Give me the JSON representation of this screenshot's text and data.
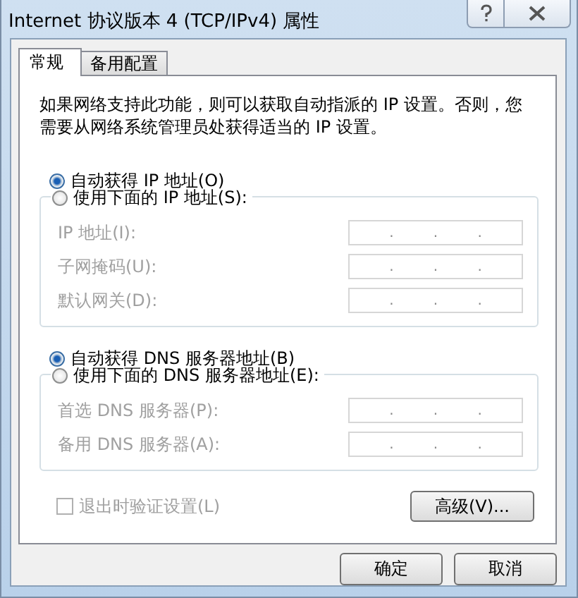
{
  "window": {
    "title": "Internet 协议版本 4 (TCP/IPv4) 属性"
  },
  "tabs": [
    {
      "label": "常规",
      "selected": true
    },
    {
      "label": "备用配置",
      "selected": false
    }
  ],
  "description": "如果网络支持此功能，则可以获取自动指派的 IP 设置。否则，您需要从网络系统管理员处获得适当的 IP 设置。",
  "sections": [
    {
      "radios": [
        {
          "label": "自动获得 IP 地址(O)",
          "selected": true
        },
        {
          "label": "使用下面的 IP 地址(S):",
          "selected": false
        }
      ],
      "disabled": true,
      "fields": [
        {
          "label": "IP 地址(I):",
          "separators": [
            ".",
            ".",
            "."
          ]
        },
        {
          "label": "子网掩码(U):",
          "separators": [
            ".",
            ".",
            "."
          ]
        },
        {
          "label": "默认网关(D):",
          "separators": [
            ".",
            ".",
            "."
          ]
        }
      ]
    },
    {
      "radios": [
        {
          "label": "自动获得 DNS 服务器地址(B)",
          "selected": true
        },
        {
          "label": "使用下面的 DNS 服务器地址(E):",
          "selected": false
        }
      ],
      "disabled": true,
      "fields": [
        {
          "label": "首选 DNS 服务器(P):",
          "separators": [
            ".",
            ".",
            "."
          ]
        },
        {
          "label": "备用 DNS 服务器(A):",
          "separators": [
            ".",
            ".",
            "."
          ]
        }
      ]
    }
  ],
  "validate_checkbox": {
    "label": "退出时验证设置(L)",
    "checked": false,
    "disabled": true
  },
  "advanced_button": "高级(V)...",
  "buttons": [
    "确定",
    "取消"
  ]
}
